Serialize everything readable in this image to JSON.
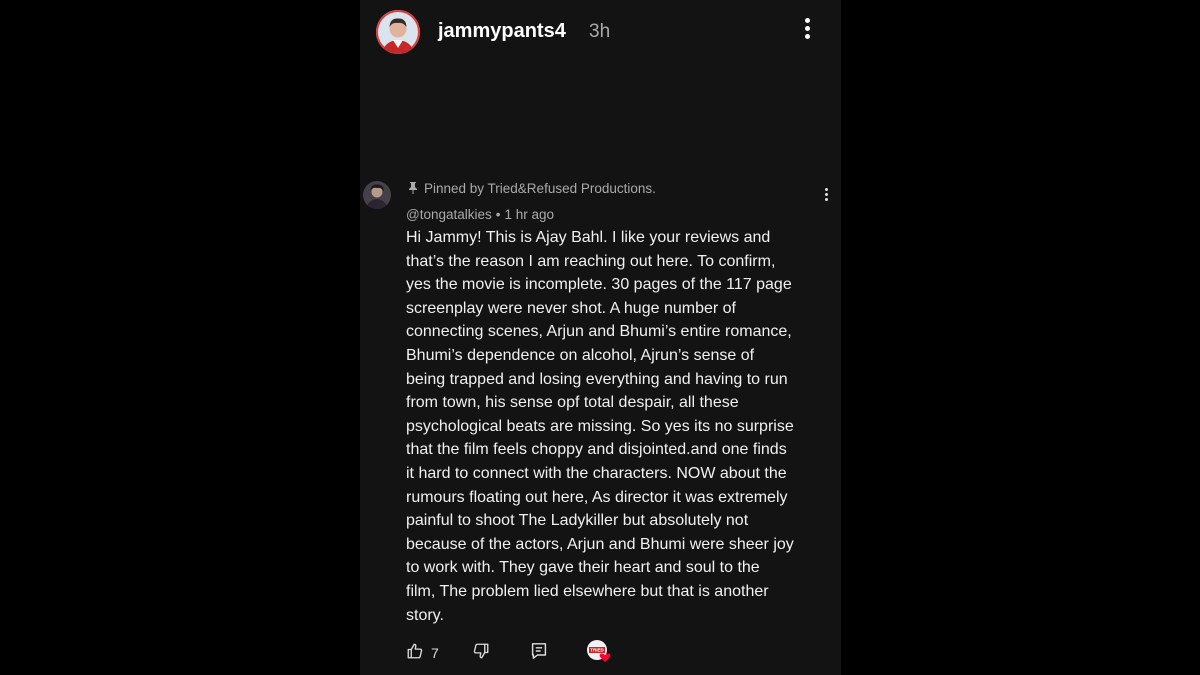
{
  "story": {
    "username": "jammypants4",
    "time": "3h"
  },
  "comment": {
    "pinned_text": "Pinned by Tried&Refused Productions.",
    "author": "@tongatalkies",
    "separator": "•",
    "time": "1 hr ago",
    "lines": [
      "Hi Jammy! This is Ajay Bahl. I like your reviews and",
      "that’s the reason  I am reaching out here.  To confirm,",
      "yes the movie is incomplete. 30 pages of the 117 page",
      "screenplay were never shot. A huge  number of",
      "connecting scenes, Arjun and Bhumi’s entire romance,",
      "Bhumi’s dependence on alcohol, Ajrun’s sense of",
      "being trapped and losing everything and having to run",
      "from town, his sense opf total despair, all these",
      "psychological beats are missing. So yes its no surprise",
      "that the film feels choppy and disjointed.and one finds",
      "it hard to connect with the characters. NOW about the",
      "rumours floating out here, As director it was extremely",
      "painful to shoot  The Ladykiller but absolutely not",
      "because of the actors, Arjun and Bhumi were sheer joy",
      "to work with. They gave their heart and soul to the",
      "film, The problem lied elsewhere but that is another",
      "story."
    ],
    "like_count": "7",
    "creator_badge_text": "TRIED"
  },
  "icons": {
    "more": "more-vert-icon",
    "pin": "pin-icon",
    "like": "thumbs-up-icon",
    "dislike": "thumbs-down-icon",
    "reply": "reply-icon",
    "creator_heart": "creator-heart-icon"
  },
  "colors": {
    "background": "#000000",
    "panel": "#131313",
    "text": "#f1f1f1",
    "secondary": "#aaaaaa",
    "avatar_ring": "#e53935",
    "heart": "#ff0033"
  }
}
